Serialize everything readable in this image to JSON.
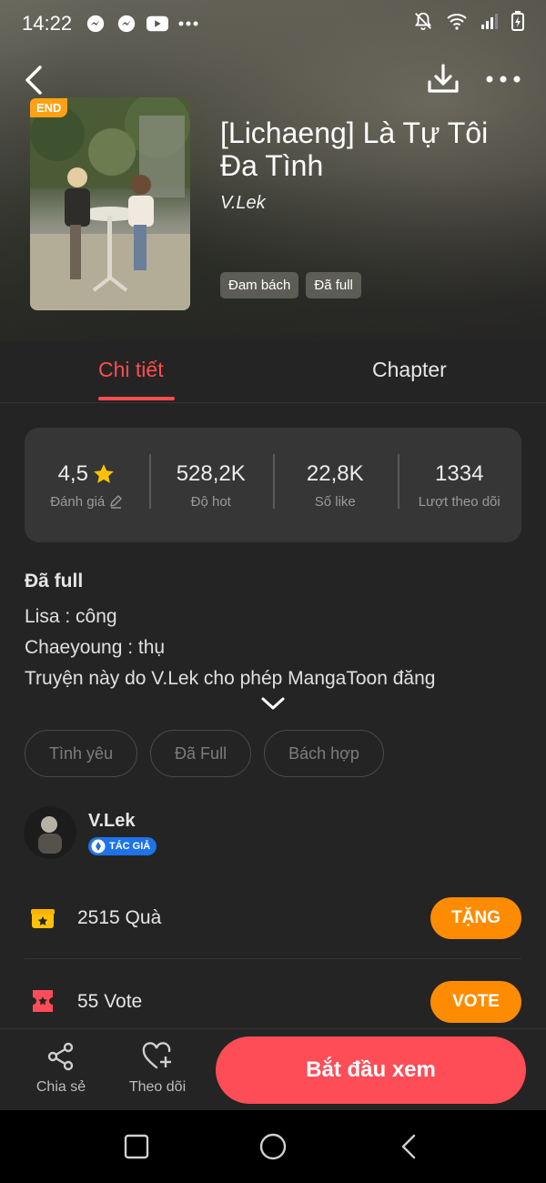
{
  "status_bar": {
    "time": "14:22",
    "icons_left": [
      "messenger-icon",
      "messenger-icon",
      "youtube-icon",
      "more-dots-icon"
    ],
    "icons_right": [
      "notifications-off-icon",
      "wifi-icon",
      "signal-icon",
      "battery-icon"
    ]
  },
  "header": {
    "back_icon": "chevron-left-icon",
    "download_icon": "download-icon",
    "more_icon": "more-horizontal-icon"
  },
  "book": {
    "badge": "END",
    "title": "[Lichaeng] Là Tự Tôi Đa Tình",
    "author": "V.Lek",
    "tags": [
      "Đam bách",
      "Đã full"
    ]
  },
  "tabs": {
    "details": "Chi tiết",
    "chapter": "Chapter",
    "active": "details"
  },
  "stats": {
    "rating": {
      "value": "4,5",
      "label": "Đánh giá"
    },
    "hot": {
      "value": "528,2K",
      "label": "Độ hot"
    },
    "likes": {
      "value": "22,8K",
      "label": "Số like"
    },
    "followers": {
      "value": "1334",
      "label": "Lượt theo dõi"
    }
  },
  "description": {
    "status": "Đã full",
    "lines": [
      "Lisa : công",
      "Chaeyoung : thụ",
      "Truyện này do V.Lek cho phép MangaToon đăng"
    ]
  },
  "genre_tags": [
    "Tình yêu",
    "Đã Full",
    "Bách hợp"
  ],
  "author_card": {
    "name": "V.Lek",
    "badge": "TÁC GIẢ"
  },
  "gifts": {
    "text": "2515 Quà",
    "button": "TẶNG"
  },
  "votes": {
    "text": "55 Vote",
    "button": "VOTE"
  },
  "bottom_bar": {
    "share_label": "Chia sẻ",
    "follow_label": "Theo dõi",
    "watch_label": "Bắt đầu xem"
  },
  "colors": {
    "accent": "#ff4d57",
    "orange": "#ff8c00",
    "gold": "#ffc107",
    "background": "#242424",
    "card": "#363636"
  }
}
